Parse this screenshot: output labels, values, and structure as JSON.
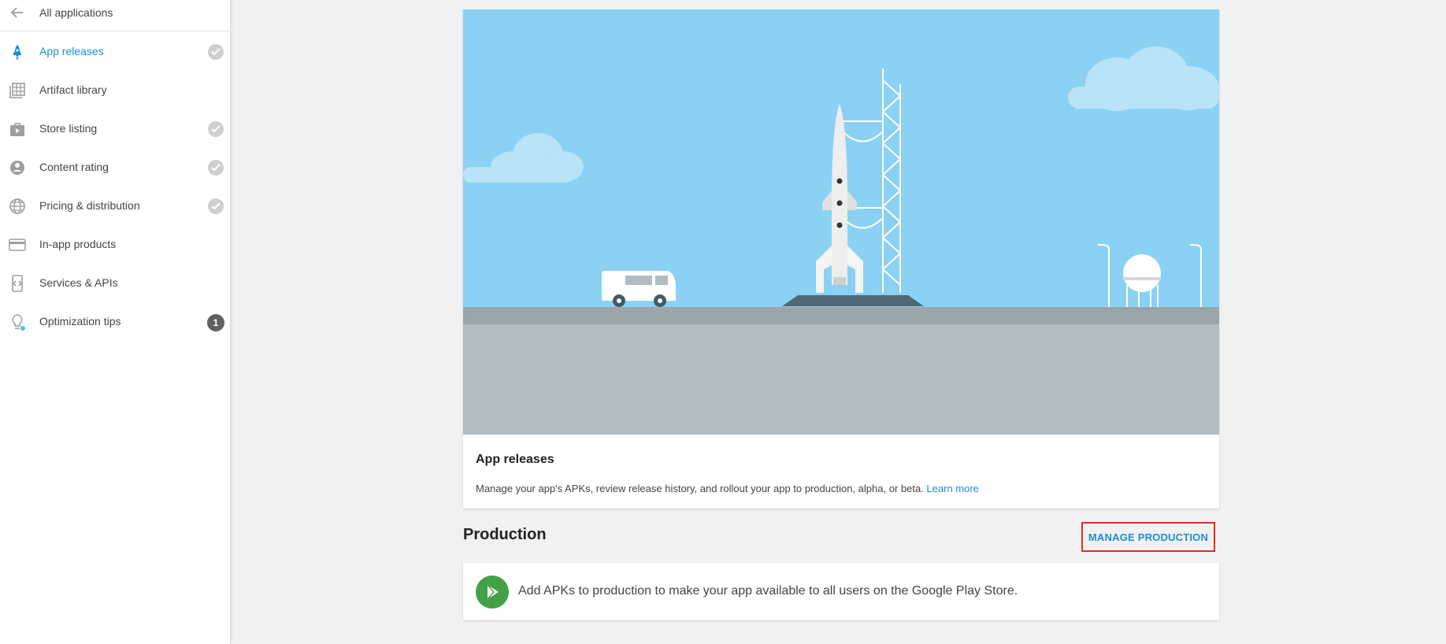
{
  "sidebar": {
    "back_label": "All applications",
    "items": [
      {
        "label": "App releases",
        "icon": "rocket-icon",
        "active": true,
        "status": "check"
      },
      {
        "label": "Artifact library",
        "icon": "grid-icon",
        "active": false,
        "status": "none"
      },
      {
        "label": "Store listing",
        "icon": "store-bag-icon",
        "active": false,
        "status": "check"
      },
      {
        "label": "Content rating",
        "icon": "rating-icon",
        "active": false,
        "status": "check"
      },
      {
        "label": "Pricing & distribution",
        "icon": "globe-icon",
        "active": false,
        "status": "check"
      },
      {
        "label": "In-app products",
        "icon": "card-icon",
        "active": false,
        "status": "none"
      },
      {
        "label": "Services & APIs",
        "icon": "api-icon",
        "active": false,
        "status": "none"
      },
      {
        "label": "Optimization tips",
        "icon": "lightbulb-icon",
        "active": false,
        "status": "1"
      }
    ]
  },
  "hero": {
    "title": "App releases",
    "description": "Manage your app's APKs, review release history, and rollout your app to production, alpha, or beta.",
    "learn_more": "Learn more"
  },
  "production": {
    "heading": "Production",
    "manage_button": "MANAGE PRODUCTION",
    "info_text": "Add APKs to production to make your app available to all users on the Google Play Store."
  },
  "colors": {
    "accent": "#1a8fd6",
    "play_green": "#43a047",
    "highlight_red": "#e02a2a"
  }
}
